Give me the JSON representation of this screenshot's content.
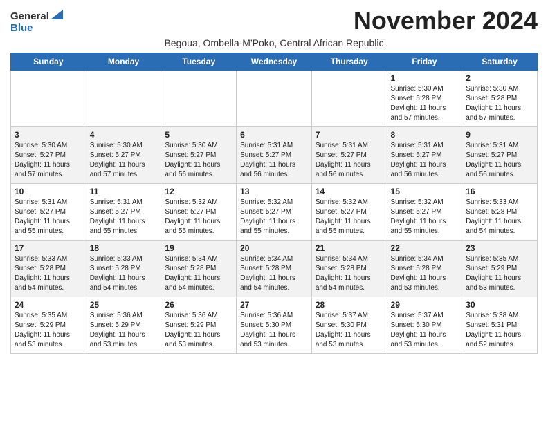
{
  "logo": {
    "line1": "General",
    "line2": "Blue"
  },
  "title": "November 2024",
  "subtitle": "Begoua, Ombella-M'Poko, Central African Republic",
  "days_of_week": [
    "Sunday",
    "Monday",
    "Tuesday",
    "Wednesday",
    "Thursday",
    "Friday",
    "Saturday"
  ],
  "weeks": [
    [
      {
        "day": "",
        "info": ""
      },
      {
        "day": "",
        "info": ""
      },
      {
        "day": "",
        "info": ""
      },
      {
        "day": "",
        "info": ""
      },
      {
        "day": "",
        "info": ""
      },
      {
        "day": "1",
        "info": "Sunrise: 5:30 AM\nSunset: 5:28 PM\nDaylight: 11 hours and 57 minutes."
      },
      {
        "day": "2",
        "info": "Sunrise: 5:30 AM\nSunset: 5:28 PM\nDaylight: 11 hours and 57 minutes."
      }
    ],
    [
      {
        "day": "3",
        "info": "Sunrise: 5:30 AM\nSunset: 5:27 PM\nDaylight: 11 hours and 57 minutes."
      },
      {
        "day": "4",
        "info": "Sunrise: 5:30 AM\nSunset: 5:27 PM\nDaylight: 11 hours and 57 minutes."
      },
      {
        "day": "5",
        "info": "Sunrise: 5:30 AM\nSunset: 5:27 PM\nDaylight: 11 hours and 56 minutes."
      },
      {
        "day": "6",
        "info": "Sunrise: 5:31 AM\nSunset: 5:27 PM\nDaylight: 11 hours and 56 minutes."
      },
      {
        "day": "7",
        "info": "Sunrise: 5:31 AM\nSunset: 5:27 PM\nDaylight: 11 hours and 56 minutes."
      },
      {
        "day": "8",
        "info": "Sunrise: 5:31 AM\nSunset: 5:27 PM\nDaylight: 11 hours and 56 minutes."
      },
      {
        "day": "9",
        "info": "Sunrise: 5:31 AM\nSunset: 5:27 PM\nDaylight: 11 hours and 56 minutes."
      }
    ],
    [
      {
        "day": "10",
        "info": "Sunrise: 5:31 AM\nSunset: 5:27 PM\nDaylight: 11 hours and 55 minutes."
      },
      {
        "day": "11",
        "info": "Sunrise: 5:31 AM\nSunset: 5:27 PM\nDaylight: 11 hours and 55 minutes."
      },
      {
        "day": "12",
        "info": "Sunrise: 5:32 AM\nSunset: 5:27 PM\nDaylight: 11 hours and 55 minutes."
      },
      {
        "day": "13",
        "info": "Sunrise: 5:32 AM\nSunset: 5:27 PM\nDaylight: 11 hours and 55 minutes."
      },
      {
        "day": "14",
        "info": "Sunrise: 5:32 AM\nSunset: 5:27 PM\nDaylight: 11 hours and 55 minutes."
      },
      {
        "day": "15",
        "info": "Sunrise: 5:32 AM\nSunset: 5:27 PM\nDaylight: 11 hours and 55 minutes."
      },
      {
        "day": "16",
        "info": "Sunrise: 5:33 AM\nSunset: 5:28 PM\nDaylight: 11 hours and 54 minutes."
      }
    ],
    [
      {
        "day": "17",
        "info": "Sunrise: 5:33 AM\nSunset: 5:28 PM\nDaylight: 11 hours and 54 minutes."
      },
      {
        "day": "18",
        "info": "Sunrise: 5:33 AM\nSunset: 5:28 PM\nDaylight: 11 hours and 54 minutes."
      },
      {
        "day": "19",
        "info": "Sunrise: 5:34 AM\nSunset: 5:28 PM\nDaylight: 11 hours and 54 minutes."
      },
      {
        "day": "20",
        "info": "Sunrise: 5:34 AM\nSunset: 5:28 PM\nDaylight: 11 hours and 54 minutes."
      },
      {
        "day": "21",
        "info": "Sunrise: 5:34 AM\nSunset: 5:28 PM\nDaylight: 11 hours and 54 minutes."
      },
      {
        "day": "22",
        "info": "Sunrise: 5:34 AM\nSunset: 5:28 PM\nDaylight: 11 hours and 53 minutes."
      },
      {
        "day": "23",
        "info": "Sunrise: 5:35 AM\nSunset: 5:29 PM\nDaylight: 11 hours and 53 minutes."
      }
    ],
    [
      {
        "day": "24",
        "info": "Sunrise: 5:35 AM\nSunset: 5:29 PM\nDaylight: 11 hours and 53 minutes."
      },
      {
        "day": "25",
        "info": "Sunrise: 5:36 AM\nSunset: 5:29 PM\nDaylight: 11 hours and 53 minutes."
      },
      {
        "day": "26",
        "info": "Sunrise: 5:36 AM\nSunset: 5:29 PM\nDaylight: 11 hours and 53 minutes."
      },
      {
        "day": "27",
        "info": "Sunrise: 5:36 AM\nSunset: 5:30 PM\nDaylight: 11 hours and 53 minutes."
      },
      {
        "day": "28",
        "info": "Sunrise: 5:37 AM\nSunset: 5:30 PM\nDaylight: 11 hours and 53 minutes."
      },
      {
        "day": "29",
        "info": "Sunrise: 5:37 AM\nSunset: 5:30 PM\nDaylight: 11 hours and 53 minutes."
      },
      {
        "day": "30",
        "info": "Sunrise: 5:38 AM\nSunset: 5:31 PM\nDaylight: 11 hours and 52 minutes."
      }
    ]
  ]
}
